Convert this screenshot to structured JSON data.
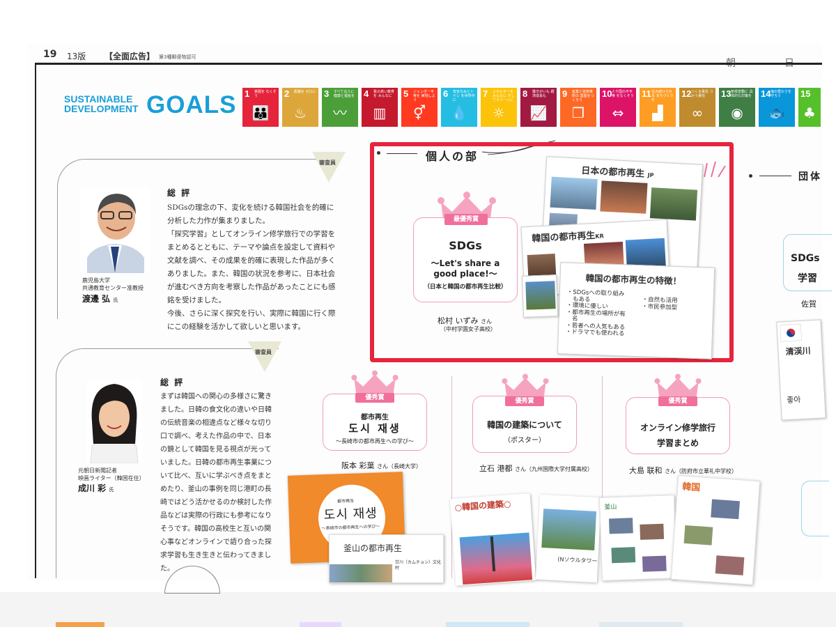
{
  "header": {
    "page_number": "19",
    "edition": "13版",
    "ad_tag": "【全面広告】",
    "permit": "第3種郵便物認可",
    "newspaper_right_1": "朝",
    "newspaper_right_2": "日"
  },
  "sdg_logo": {
    "line1": "SUSTAINABLE",
    "line2": "DEVELOPMENT",
    "goals": "GOALS"
  },
  "sdg_icons": [
    {
      "num": "1",
      "caption": "貧困を なくそう",
      "icon": "family-icon",
      "color": "#e5243b"
    },
    {
      "num": "2",
      "caption": "飢餓を ゼロに",
      "icon": "bowl-icon",
      "color": "#dda63a"
    },
    {
      "num": "3",
      "caption": "すべての人に 健康と福祉を",
      "icon": "heartbeat-icon",
      "color": "#4c9f38"
    },
    {
      "num": "4",
      "caption": "質の高い教育を みんなに",
      "icon": "book-icon",
      "color": "#c5192d"
    },
    {
      "num": "5",
      "caption": "ジェンダー平等を 実現しよう",
      "icon": "gender-icon",
      "color": "#ff3a21"
    },
    {
      "num": "6",
      "caption": "安全な水とトイレ を世界中に",
      "icon": "water-drop-icon",
      "color": "#26bde2"
    },
    {
      "num": "7",
      "caption": "エネルギーをみんなに そしてクリーンに",
      "icon": "sun-icon",
      "color": "#fcc30b"
    },
    {
      "num": "8",
      "caption": "働きがいも 経済成長も",
      "icon": "growth-chart-icon",
      "color": "#a21942"
    },
    {
      "num": "9",
      "caption": "産業と技術革新の 基盤をつくろう",
      "icon": "cubes-icon",
      "color": "#fd6925"
    },
    {
      "num": "10",
      "caption": "人や国の不平等 をなくそう",
      "icon": "equality-icon",
      "color": "#dd1367"
    },
    {
      "num": "11",
      "caption": "住み続けられる まちづくりを",
      "icon": "city-icon",
      "color": "#fd9d24"
    },
    {
      "num": "12",
      "caption": "つくる責任 つかう責任",
      "icon": "infinity-icon",
      "color": "#bf8b2e"
    },
    {
      "num": "13",
      "caption": "気候変動に 具体的な対策を",
      "icon": "eye-icon",
      "color": "#3f7e44"
    },
    {
      "num": "14",
      "caption": "海の豊かさを 守ろう",
      "icon": "fish-icon",
      "color": "#0a97d9"
    },
    {
      "num": "15",
      "caption": "",
      "icon": "tree-icon",
      "color": "#56c02b"
    }
  ],
  "judges": [
    {
      "badge": "審査員",
      "section": "総 評",
      "affiliation": [
        "鹿児島大学",
        "共通教育センター准教授"
      ],
      "name": "渡邊 弘",
      "honorific": "氏",
      "comment": [
        "SDGsの理念の下、変化を続ける韓国社会を的確に分析した力作が集まりました。",
        "「探究学習」としてオンライン修学旅行での学習をまとめるとともに、テーマや論点を設定して資料や文献を調べ、その成果を的確に表現した作品が多くありました。また、韓国の状況を参考に、日本社会が進むべき方向を考察した作品があったことにも感銘を受けました。",
        "今後、さらに深く探究を行い、実際に韓国に行く際にこの経験を活かして欲しいと思います。"
      ]
    },
    {
      "badge": "審査員",
      "section": "総 評",
      "affiliation": [
        "元朝日新聞記者",
        "映画ライター（韓国在住）"
      ],
      "name": "成川 彩",
      "honorific": "氏",
      "comment": [
        "まずは韓国への関心の多様さに驚きました。日韓の食文化の違いや日韓の伝統音楽の相違点など様々な切り口で調べ、考えた作品の中で、日本の鏡として韓国を見る視点が光っていました。日韓の都市再生事業について比べ、互いに学ぶべき点をまとめたり、釜山の事例を同じ港町の長崎ではどう活かせるのか検討した作品などは実際の行政にも参考になりそうです。韓国の高校生と互いの関心事などオンラインで語り合った探求学習も生き生きと伝わってきました。"
      ]
    }
  ],
  "individual": {
    "title": "個人の部",
    "grand_prize": {
      "badge": "最優秀賞",
      "title": "SDGs",
      "subtitle": "～Let's share a good place!～",
      "note": "（日本と韓国の都市再生比較）",
      "author": "松村 いずみ",
      "honorific": "さん",
      "school": "（中村学園女子高校）"
    },
    "poster": {
      "japan_title": "日本の都市再生",
      "japan_tag": "JP",
      "korea_title": "韓国の都市再生",
      "korea_tag": "KR",
      "features_title": "韓国の都市再生の特徴！",
      "features_left": [
        "・SDGsへの取り組み",
        "　もある",
        "・環境に優しい",
        "・都市再生の場所が有",
        "　名",
        "・若者への人気もある",
        "・ドラマでも使われる"
      ],
      "features_right": [
        "・自然も活用",
        "・市民参加型"
      ]
    }
  },
  "group_title": "団体",
  "excellence": [
    {
      "badge": "優秀賞",
      "line1": "都市再生",
      "line2": "도시 재생",
      "line3": "～長崎市の都市再生への学び～",
      "author": "阪本 彩葉",
      "honorific": "さん",
      "school": "（長崎大学）"
    },
    {
      "badge": "優秀賞",
      "line1": "韓国の建築について",
      "line2": "（ポスター）",
      "author": "立石 港都",
      "honorific": "さん",
      "school": "（九州国際大学付属高校）"
    },
    {
      "badge": "優秀賞",
      "line1": "オンライン修学旅行",
      "line2": "学習まとめ",
      "author": "大島 联和",
      "honorific": "さん",
      "school": "（防府市立華礼中学校）"
    }
  ],
  "right_column": {
    "text1": "SDGs",
    "text2": "学習",
    "text3": "佐賀",
    "card_text": "清渓川",
    "hangul": "좋아"
  },
  "posters": {
    "p1_title": "도시 재생",
    "p1_small": "都市再生",
    "p1_sub": "～長崎市の都市再生への学び～",
    "p1_busan": "釜山の都市再生",
    "p1_place": "甘川（カムチョン）文化村",
    "p2_title": "○韓国の建築○",
    "p2_tower": "(Nソウルタワー)",
    "p3_korea": "韓国",
    "p3_busan": "釜山"
  }
}
